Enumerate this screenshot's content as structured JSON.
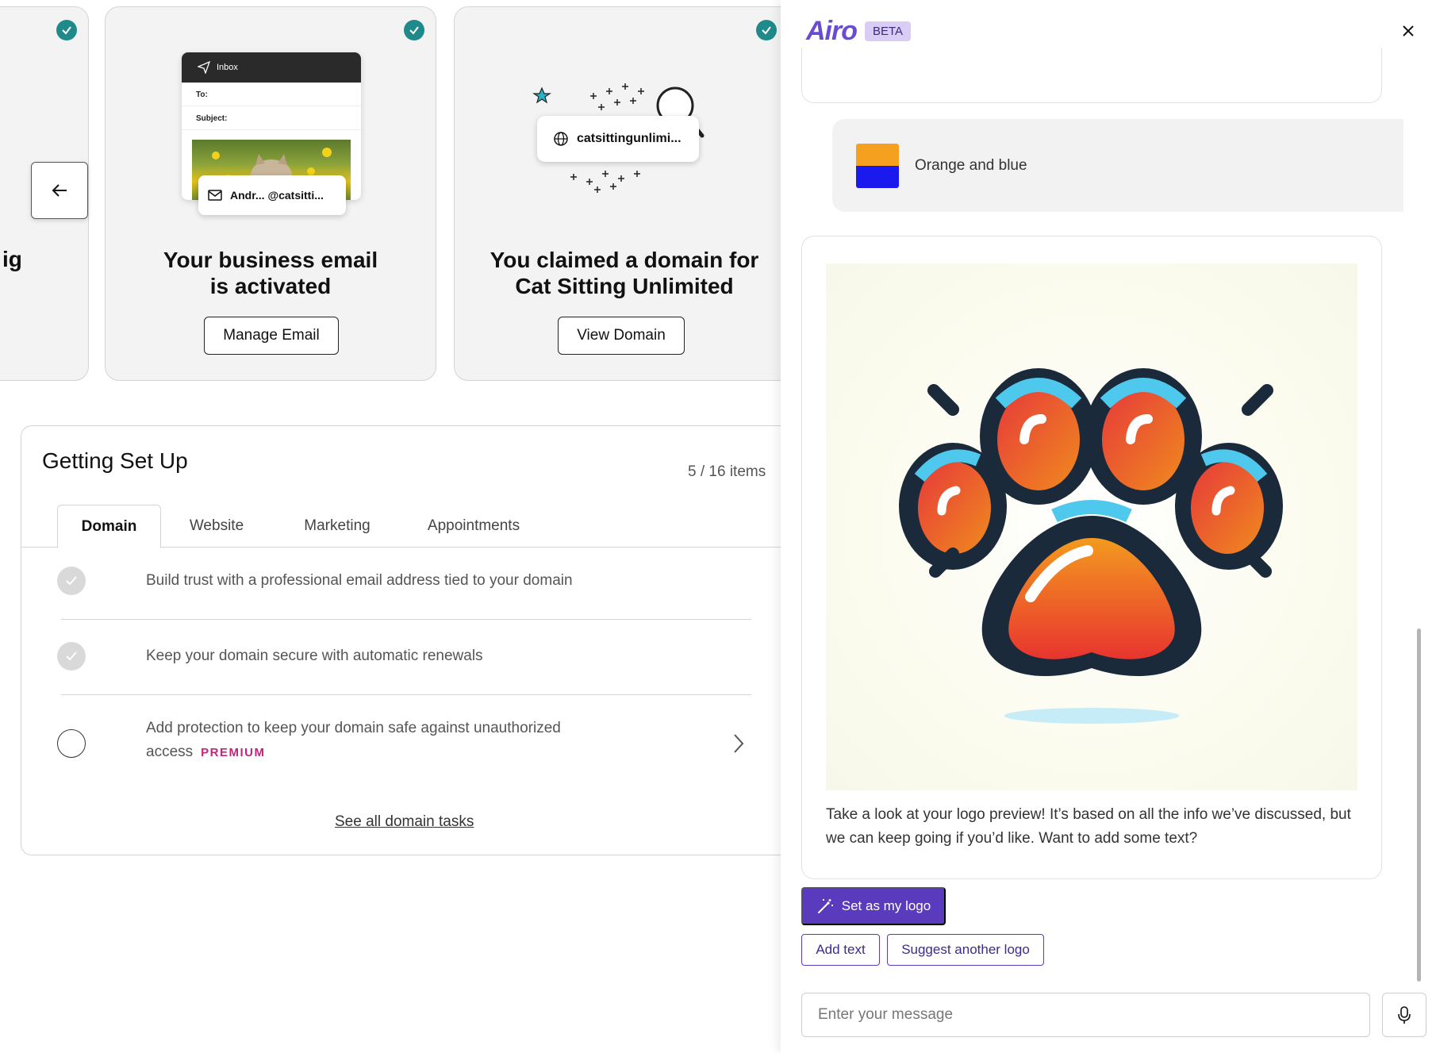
{
  "cards": {
    "partial_title": "ig",
    "email": {
      "inbox_label": "Inbox",
      "to_label": "To:",
      "subject_label": "Subject:",
      "chip_text": "Andr...  @catsitti...",
      "title": "Your business email is activated",
      "button": "Manage Email"
    },
    "domain": {
      "chip_text": "catsittingunlimi...",
      "title": "You claimed a domain for Cat Sitting Unlimited",
      "button": "View Domain"
    }
  },
  "setup": {
    "title": "Getting Set Up",
    "count": "5 / 16 items",
    "tabs": [
      "Domain",
      "Website",
      "Marketing",
      "Appointments"
    ],
    "active_tab": "Domain",
    "tasks": [
      {
        "text": "Build trust with a professional email address tied to your domain",
        "done": true
      },
      {
        "text": "Keep your domain secure with automatic renewals",
        "done": true
      },
      {
        "text": "Add protection to keep your domain safe against unauthorized access",
        "done": false,
        "badge": "PREMIUM"
      }
    ],
    "see_all": "See all domain tasks"
  },
  "assistant": {
    "brand": "Airo",
    "badge": "BETA",
    "user_message": "Orange and blue",
    "swatch_colors": [
      "#f5a01e",
      "#1a1aee"
    ],
    "ai_message": "Take a look at your logo preview! It’s based on all the info we’ve discussed, but we can keep going if you’d like. Want to add some text?",
    "primary_action": "Set as my logo",
    "actions": [
      "Add text",
      "Suggest another logo"
    ],
    "input_placeholder": "Enter your message"
  },
  "colors": {
    "accent": "#5b3bbd",
    "check_teal": "#1f8a8a",
    "premium": "#c0267a"
  }
}
